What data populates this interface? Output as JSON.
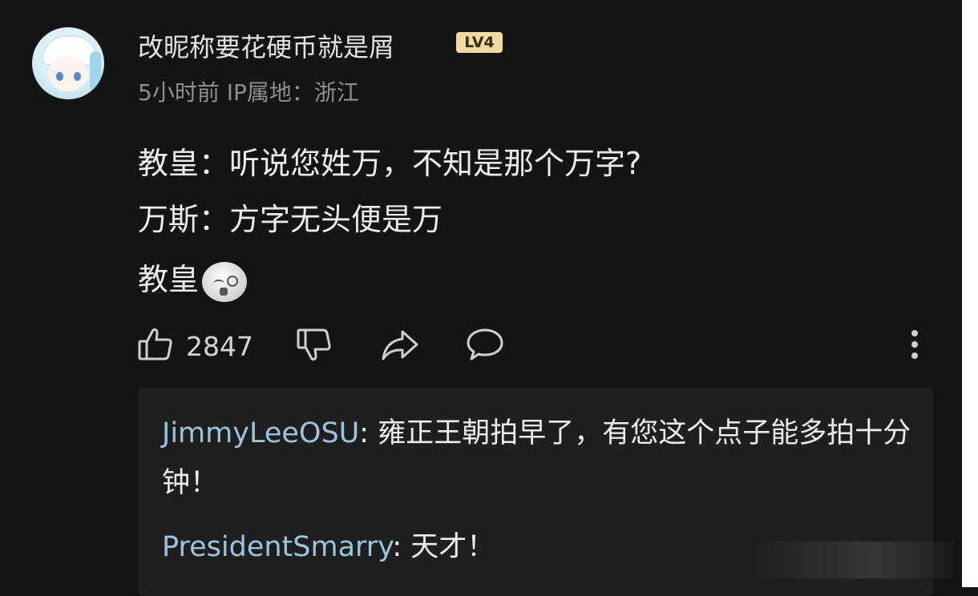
{
  "comment": {
    "username": "改昵称要花硬币就是屑",
    "level": "LV4",
    "meta": "5小时前 IP属地：浙江",
    "lines": [
      "教皇：听说您姓万，不知是那个万字?",
      "万斯：方字无头便是万",
      "教皇"
    ],
    "emoji_icon": "dizzy-face-emoji",
    "likes": "2847"
  },
  "actions": {
    "like_icon": "thumbs-up-icon",
    "dislike_icon": "thumbs-down-icon",
    "share_icon": "share-arrow-icon",
    "comment_icon": "comment-bubble-icon",
    "more_icon": "more-vertical-icon"
  },
  "replies": [
    {
      "author": "JimmyLeeOSU",
      "text": ": 雍正王朝拍早了，有您这个点子能多拍十分钟！"
    },
    {
      "author": "PresidentSmarry",
      "text": ": 天才！"
    }
  ],
  "colors": {
    "background": "#141414",
    "reply_panel": "#1f1f1f",
    "author_link": "#9cc4dd",
    "level_badge": "#f0d9a4"
  }
}
